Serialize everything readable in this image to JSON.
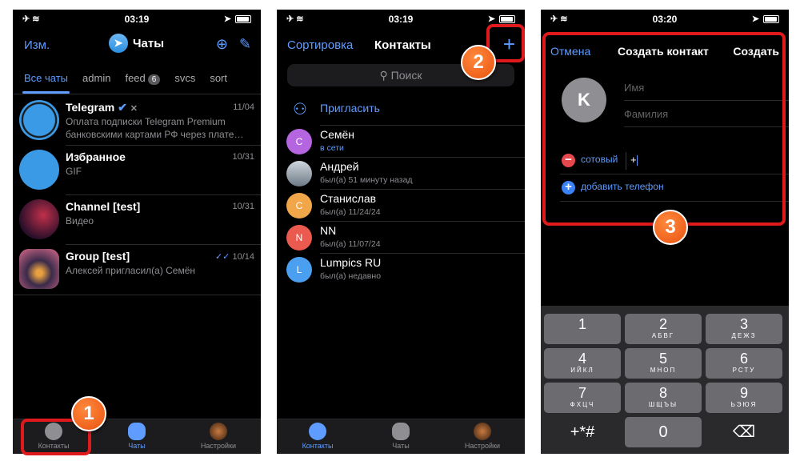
{
  "colors": {
    "accent": "#5e9cff",
    "background": "#000000",
    "highlight": "#e0191d",
    "step_badge": "#f06a1c"
  },
  "screen1": {
    "status": {
      "time": "03:19"
    },
    "header": {
      "edit_label": "Изм.",
      "title": "Чаты",
      "icons": [
        "new-story-icon",
        "compose-icon"
      ]
    },
    "folders": [
      {
        "label": "Все чаты",
        "active": true
      },
      {
        "label": "admin"
      },
      {
        "label": "feed",
        "badge": "6"
      },
      {
        "label": "svcs"
      },
      {
        "label": "sort"
      }
    ],
    "chats": [
      {
        "name": "Telegram",
        "date": "11/04",
        "message": "Оплата подписки Telegram Premium банковскими картами РФ через плате…",
        "verified": true,
        "muted": true
      },
      {
        "name": "Избранное",
        "date": "10/31",
        "message": "GIF"
      },
      {
        "name": "Channel [test]",
        "date": "10/31",
        "message": "Видео"
      },
      {
        "name": "Group [test]",
        "date": "10/14",
        "message": "Алексей пригласил(а) Семён",
        "read": true
      }
    ],
    "tabbar": {
      "contacts": "Контакты",
      "chats": "Чаты",
      "settings": "Настройки"
    }
  },
  "screen2": {
    "status": {
      "time": "03:19"
    },
    "header": {
      "sort_label": "Сортировка",
      "title": "Контакты",
      "add_label": "+"
    },
    "search_placeholder": "Поиск",
    "invite_label": "Пригласить",
    "contacts": [
      {
        "initial": "С",
        "name": "Семён",
        "status": "в сети",
        "online": true,
        "color": "#b565e0"
      },
      {
        "initial": "",
        "name": "Андрей",
        "status": "был(а) 51 минуту назад",
        "color": "#9a9a9e"
      },
      {
        "initial": "С",
        "name": "Станислав",
        "status": "был(а) 11/24/24",
        "color": "#f2a64a"
      },
      {
        "initial": "N",
        "name": "NN",
        "status": "был(а) 11/07/24",
        "color": "#ea5a4e"
      },
      {
        "initial": "L",
        "name": "Lumpics RU",
        "status": "был(а) недавно",
        "color": "#4a9ff0"
      }
    ],
    "tabbar": {
      "contacts": "Контакты",
      "chats": "Чаты",
      "settings": "Настройки"
    }
  },
  "screen3": {
    "status": {
      "time": "03:20"
    },
    "header": {
      "cancel_label": "Отмена",
      "title": "Создать контакт",
      "create_label": "Создать"
    },
    "avatar_initial": "K",
    "first_name_placeholder": "Имя",
    "last_name_placeholder": "Фамилия",
    "phone_label": "сотовый",
    "phone_value": "+",
    "add_phone_label": "добавить телефон",
    "keypad": [
      {
        "digit": "1",
        "letters": ""
      },
      {
        "digit": "2",
        "letters": "АБВГ"
      },
      {
        "digit": "3",
        "letters": "ДЕЖЗ"
      },
      {
        "digit": "4",
        "letters": "ИЙКЛ"
      },
      {
        "digit": "5",
        "letters": "МНОП"
      },
      {
        "digit": "6",
        "letters": "РСТУ"
      },
      {
        "digit": "7",
        "letters": "ФХЦЧ"
      },
      {
        "digit": "8",
        "letters": "ШЩЪЫ"
      },
      {
        "digit": "9",
        "letters": "ЬЭЮЯ"
      },
      {
        "digit": "+*#",
        "letters": ""
      },
      {
        "digit": "0",
        "letters": ""
      },
      {
        "digit": "⌫",
        "letters": ""
      }
    ]
  },
  "annotations": {
    "step1": "1",
    "step2": "2",
    "step3": "3"
  }
}
